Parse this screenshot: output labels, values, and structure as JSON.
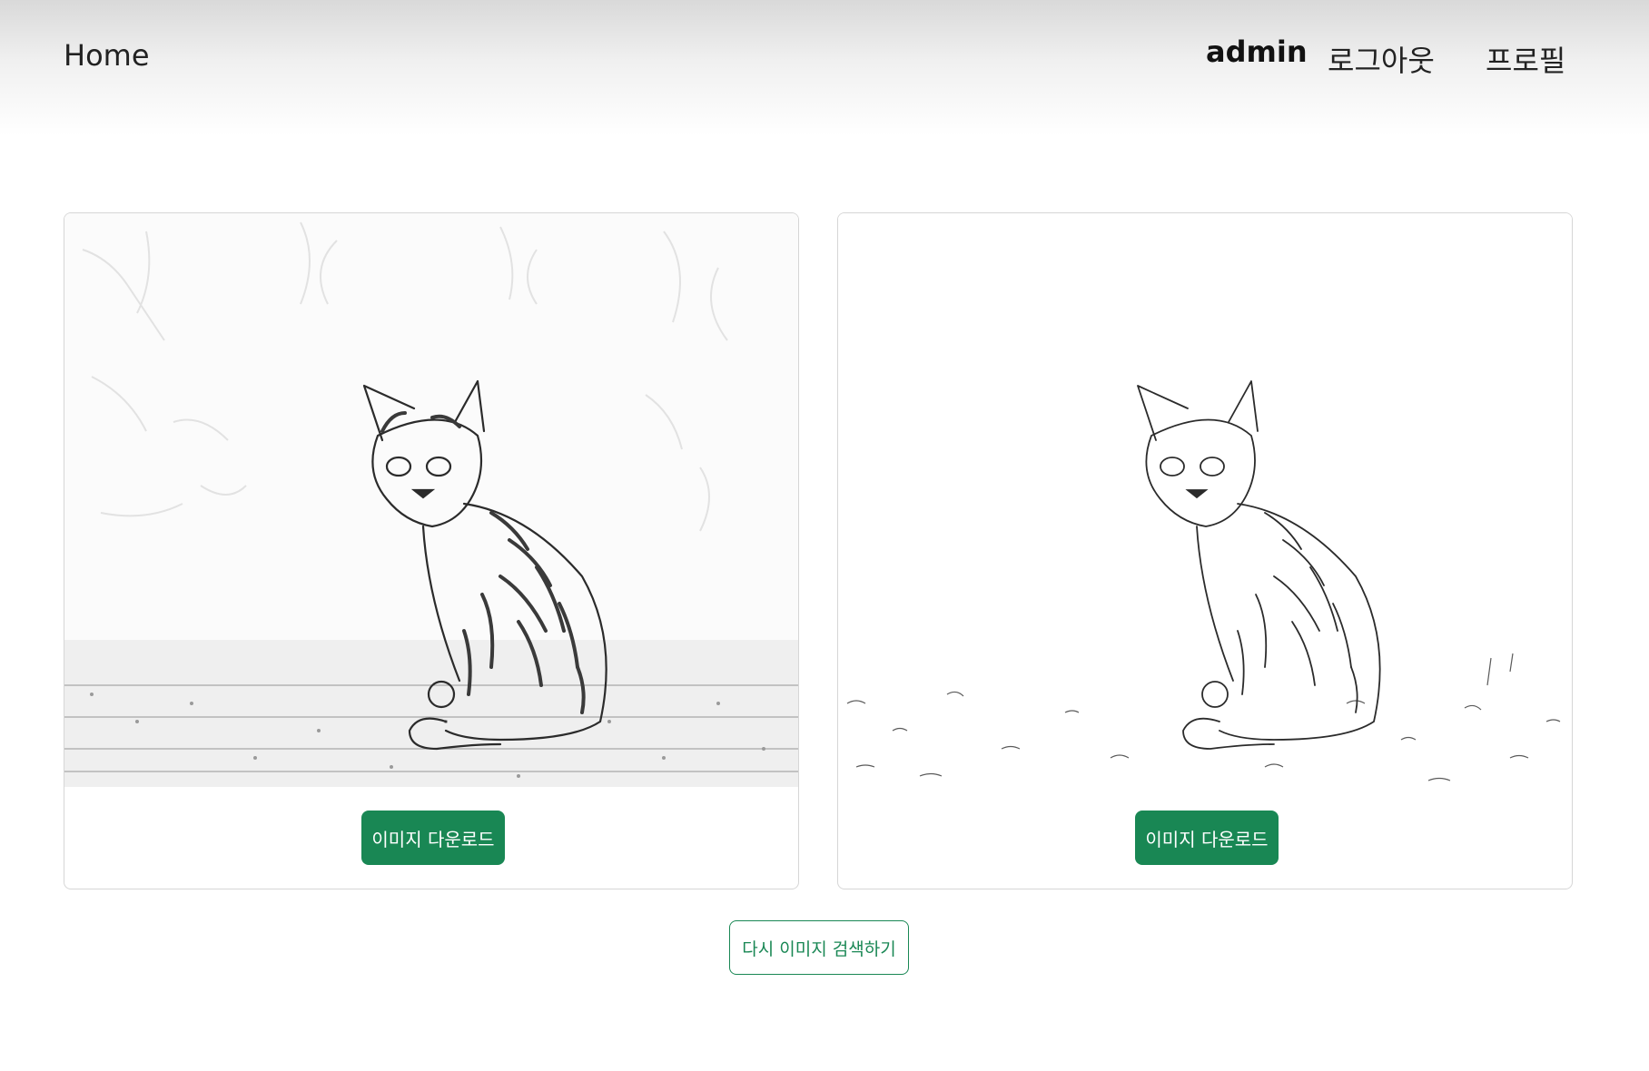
{
  "navbar": {
    "home_label": "Home",
    "username": "admin",
    "logout_label": "로그아웃",
    "profile_label": "프로필"
  },
  "cards": [
    {
      "image_description": "pencil sketch of a tabby kitten sitting on ground (shaded)",
      "download_label": "이미지 다운로드"
    },
    {
      "image_description": "line sketch of a tabby kitten sitting on ground (outline)",
      "download_label": "이미지 다운로드"
    }
  ],
  "research_label": "다시 이미지 검색하기",
  "colors": {
    "primary_green": "#198754",
    "card_border": "#d6d6d6"
  }
}
